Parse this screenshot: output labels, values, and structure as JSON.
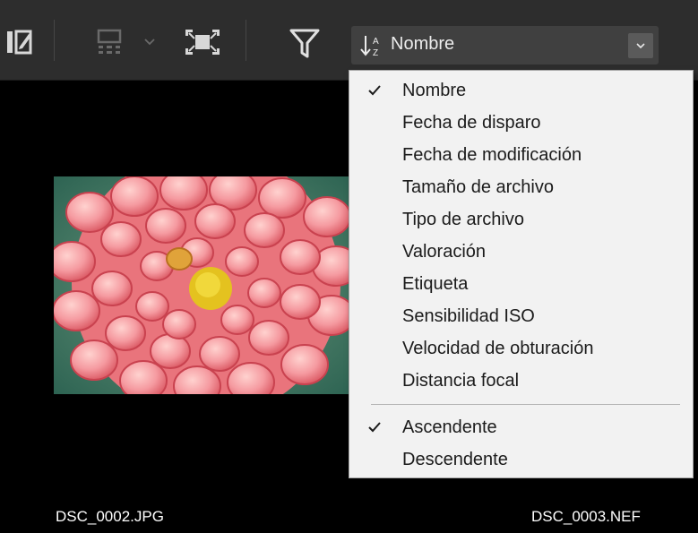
{
  "toolbar": {
    "sort_selected": "Nombre"
  },
  "icons": {
    "edit": "edit-icon",
    "grid_layout": "grid-layout-icon",
    "fullscreen": "fullscreen-icon",
    "filter": "filter-icon",
    "sort": "sort-az-icon",
    "dropdown_arrow": "chevron-down-icon",
    "check": "checkmark-icon"
  },
  "sort_menu": {
    "fields": [
      {
        "label": "Nombre",
        "checked": true
      },
      {
        "label": "Fecha de disparo",
        "checked": false
      },
      {
        "label": "Fecha de modificación",
        "checked": false
      },
      {
        "label": "Tamaño de archivo",
        "checked": false
      },
      {
        "label": "Tipo de archivo",
        "checked": false
      },
      {
        "label": "Valoración",
        "checked": false
      },
      {
        "label": "Etiqueta",
        "checked": false
      },
      {
        "label": "Sensibilidad ISO",
        "checked": false
      },
      {
        "label": "Velocidad de obturación",
        "checked": false
      },
      {
        "label": "Distancia focal",
        "checked": false
      }
    ],
    "order": [
      {
        "label": "Ascendente",
        "checked": true
      },
      {
        "label": "Descendente",
        "checked": false
      }
    ]
  },
  "files": [
    {
      "name": "DSC_0002.JPG"
    },
    {
      "name": "DSC_0003.NEF"
    }
  ],
  "colors": {
    "toolbar_bg": "#2d2d2d",
    "menu_bg": "#f2f2f2",
    "select_bg": "#404040"
  }
}
